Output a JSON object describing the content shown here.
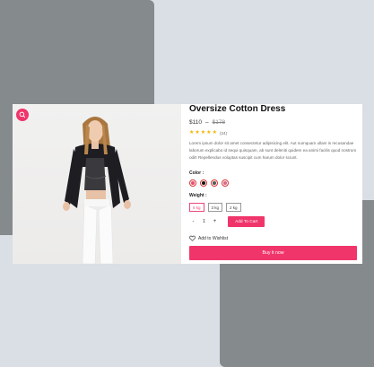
{
  "product": {
    "title": "Oversize Cotton Dress",
    "price": "$110",
    "price_separator": "–",
    "old_price": "$178",
    "rating_stars": 5,
    "rating_count": "(24)",
    "description": "Lorem ipsum dolor sit amet consectetur adipisicing elit. Aut numquam ullam is recusandae laborum explicabo id sequi quisquam, ab sunt deleniti quidem ea animi facilis quod nostrum odit! Repellendus voluptas suscipit cum harum dolor sciunt."
  },
  "color": {
    "label": "Color :",
    "swatches": [
      "#e94a7a",
      "#111111",
      "#555555",
      "#d46a8a"
    ]
  },
  "weight": {
    "label": "Weight :",
    "options": [
      "5 kg",
      "3 kg",
      "2 kg"
    ],
    "selected": "5 kg"
  },
  "quantity": {
    "minus": "-",
    "value": "1",
    "plus": "+"
  },
  "actions": {
    "add_to_cart": "Add To Cart",
    "wishlist": "Add to Wishlist",
    "buy_now": "Buy it now"
  },
  "colors": {
    "accent": "#f0356b",
    "star": "#f5b301",
    "backdrop_block": "#858a8d",
    "page_bg": "#d9dfe4"
  },
  "icons": [
    "zoom-icon",
    "heart-icon",
    "star-icon"
  ]
}
